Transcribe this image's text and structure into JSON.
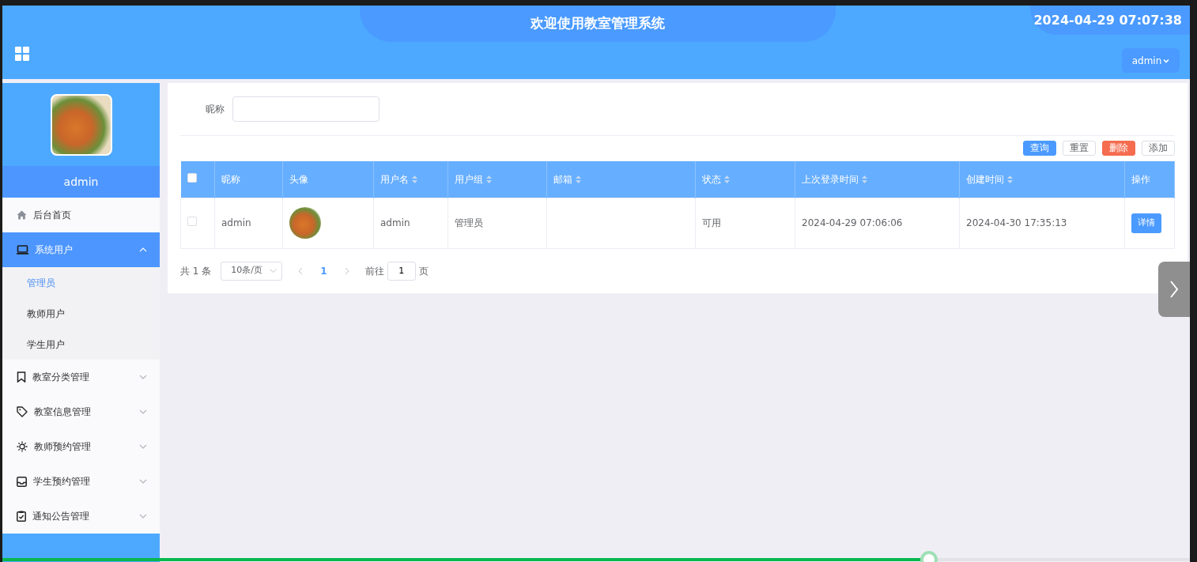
{
  "header": {
    "title": "欢迎使用教室管理系统",
    "datetime": "2024-04-29 07:07:38",
    "user_menu": "admin"
  },
  "sidebar": {
    "username": "admin",
    "menu": [
      {
        "label": "后台首页",
        "expanded": false,
        "selected": false
      },
      {
        "label": "系统用户",
        "expanded": true,
        "selected": true,
        "children": [
          {
            "label": "管理员",
            "selected": true
          },
          {
            "label": "教师用户",
            "selected": false
          },
          {
            "label": "学生用户",
            "selected": false
          }
        ]
      },
      {
        "label": "教室分类管理",
        "expanded": false,
        "selected": false
      },
      {
        "label": "教室信息管理",
        "expanded": false,
        "selected": false
      },
      {
        "label": "教师预约管理",
        "expanded": false,
        "selected": false
      },
      {
        "label": "学生预约管理",
        "expanded": false,
        "selected": false
      },
      {
        "label": "通知公告管理",
        "expanded": false,
        "selected": false
      }
    ]
  },
  "search": {
    "label": "昵称"
  },
  "buttons": [
    {
      "label": "查询",
      "kind": "primary"
    },
    {
      "label": "重置",
      "kind": "default"
    },
    {
      "label": "删除",
      "kind": "danger"
    },
    {
      "label": "添加",
      "kind": "default"
    }
  ],
  "table": {
    "select_all_checked": false,
    "columns": [
      {
        "label": "昵称",
        "kind": "text",
        "sortable": false
      },
      {
        "label": "头像",
        "kind": "image",
        "sortable": false
      },
      {
        "label": "用户名",
        "kind": "text",
        "sortable": true
      },
      {
        "label": "用户组",
        "kind": "text",
        "sortable": true
      },
      {
        "label": "邮箱",
        "kind": "text",
        "sortable": true
      },
      {
        "label": "状态",
        "kind": "text",
        "sortable": true
      },
      {
        "label": "上次登录时间",
        "kind": "text",
        "sortable": true
      },
      {
        "label": "创建时间",
        "kind": "text",
        "sortable": true
      },
      {
        "label": "操作",
        "kind": "action",
        "sortable": false
      }
    ],
    "rows": [
      {
        "checked": false,
        "cells": [
          "admin",
          null,
          "admin",
          "管理员",
          null,
          "可用",
          "2024-04-29 07:06:06",
          "2024-04-30 17:35:13",
          "详情"
        ]
      }
    ]
  },
  "pagination": {
    "total": "共 1 条",
    "page_size": "10条/页",
    "pages": [
      {
        "label": "1",
        "selected": true
      }
    ],
    "goto_label": "前往",
    "goto_value": "1",
    "page_unit": "页"
  },
  "progress": {
    "level": 0.78
  }
}
